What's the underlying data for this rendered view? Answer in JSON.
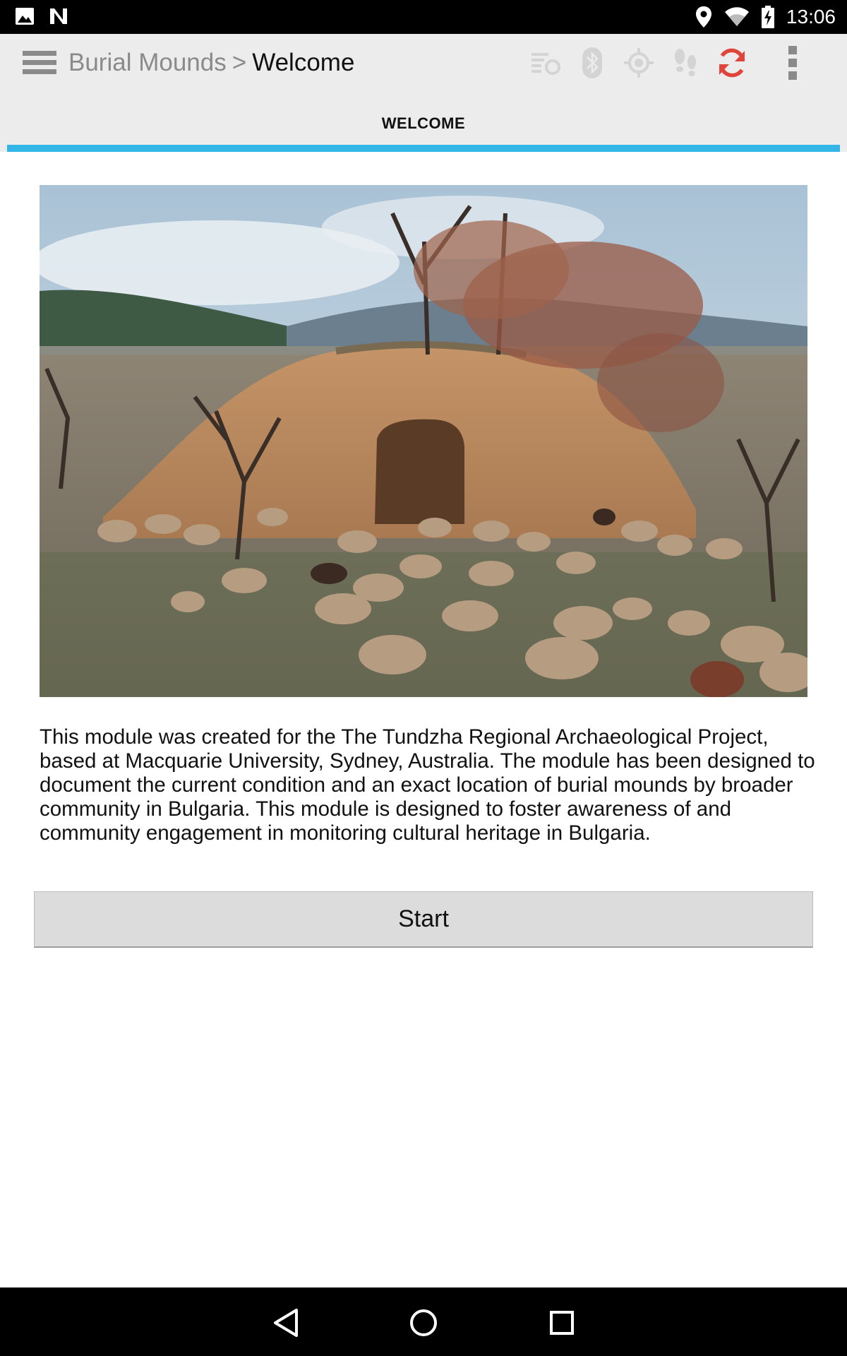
{
  "status_bar": {
    "time": "13:06",
    "left_icons": [
      "image-notification-icon",
      "n-notification-icon"
    ],
    "right_icons": [
      "location-pin-icon",
      "wifi-icon",
      "battery-charging-icon"
    ]
  },
  "action_bar": {
    "menu_icon": "hamburger-menu-icon",
    "breadcrumb_parent": "Burial Mounds",
    "breadcrumb_separator": ">",
    "breadcrumb_current": "Welcome",
    "icons": [
      "sync-list-icon",
      "bluetooth-icon",
      "gps-icon",
      "footsteps-icon",
      "sync-refresh-icon",
      "overflow-menu-icon"
    ],
    "accent_color": "#e0453c"
  },
  "tabs": [
    {
      "label": "WELCOME",
      "selected": true
    }
  ],
  "tab_indicator_color": "#33b5e5",
  "content": {
    "description": "This module was created for the The Tundzha Regional Archaeological Project, based at Macquarie University, Sydney, Australia. The module has been designed to document the current condition and an exact location of burial mounds by broader community in Bulgaria. This module is designed to foster awareness of and community engagement in monitoring cultural heritage in Bulgaria.",
    "start_button_label": "Start"
  },
  "nav_bar": {
    "icons": [
      "back-icon",
      "home-icon",
      "recents-icon"
    ]
  }
}
